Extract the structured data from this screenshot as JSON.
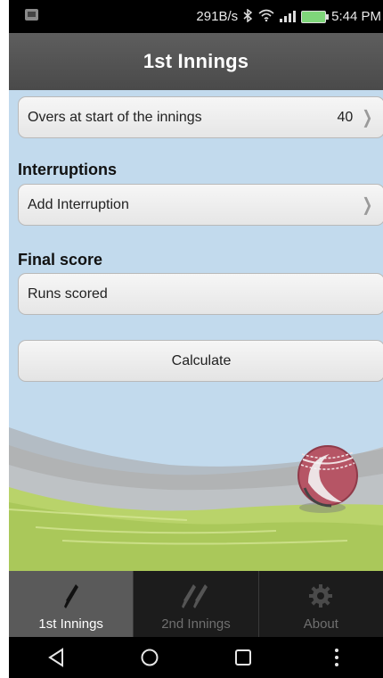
{
  "status_bar": {
    "speed": "291B/s",
    "time": "5:44 PM",
    "icons": [
      "notification-icon",
      "bluetooth-icon",
      "wifi-icon",
      "signal-icon",
      "battery-icon"
    ]
  },
  "title": "1st Innings",
  "overs": {
    "label": "Overs at start of the innings",
    "value": "40"
  },
  "interruptions": {
    "heading": "Interruptions",
    "add_label": "Add Interruption"
  },
  "final_score": {
    "heading": "Final score",
    "runs_label": "Runs scored"
  },
  "calculate_label": "Calculate",
  "tabs": [
    {
      "label": "1st Innings",
      "icon": "bat-icon",
      "active": true
    },
    {
      "label": "2nd Innings",
      "icon": "two-bats-icon",
      "active": false
    },
    {
      "label": "About",
      "icon": "gear-icon",
      "active": false
    }
  ],
  "nav": [
    "back-icon",
    "home-icon",
    "recents-icon",
    "menu-icon"
  ],
  "colors": {
    "title_bar": "#555555",
    "background": "#c2daed",
    "tab_active": "#5a5a5a",
    "tab_bar": "#1c1c1c"
  }
}
